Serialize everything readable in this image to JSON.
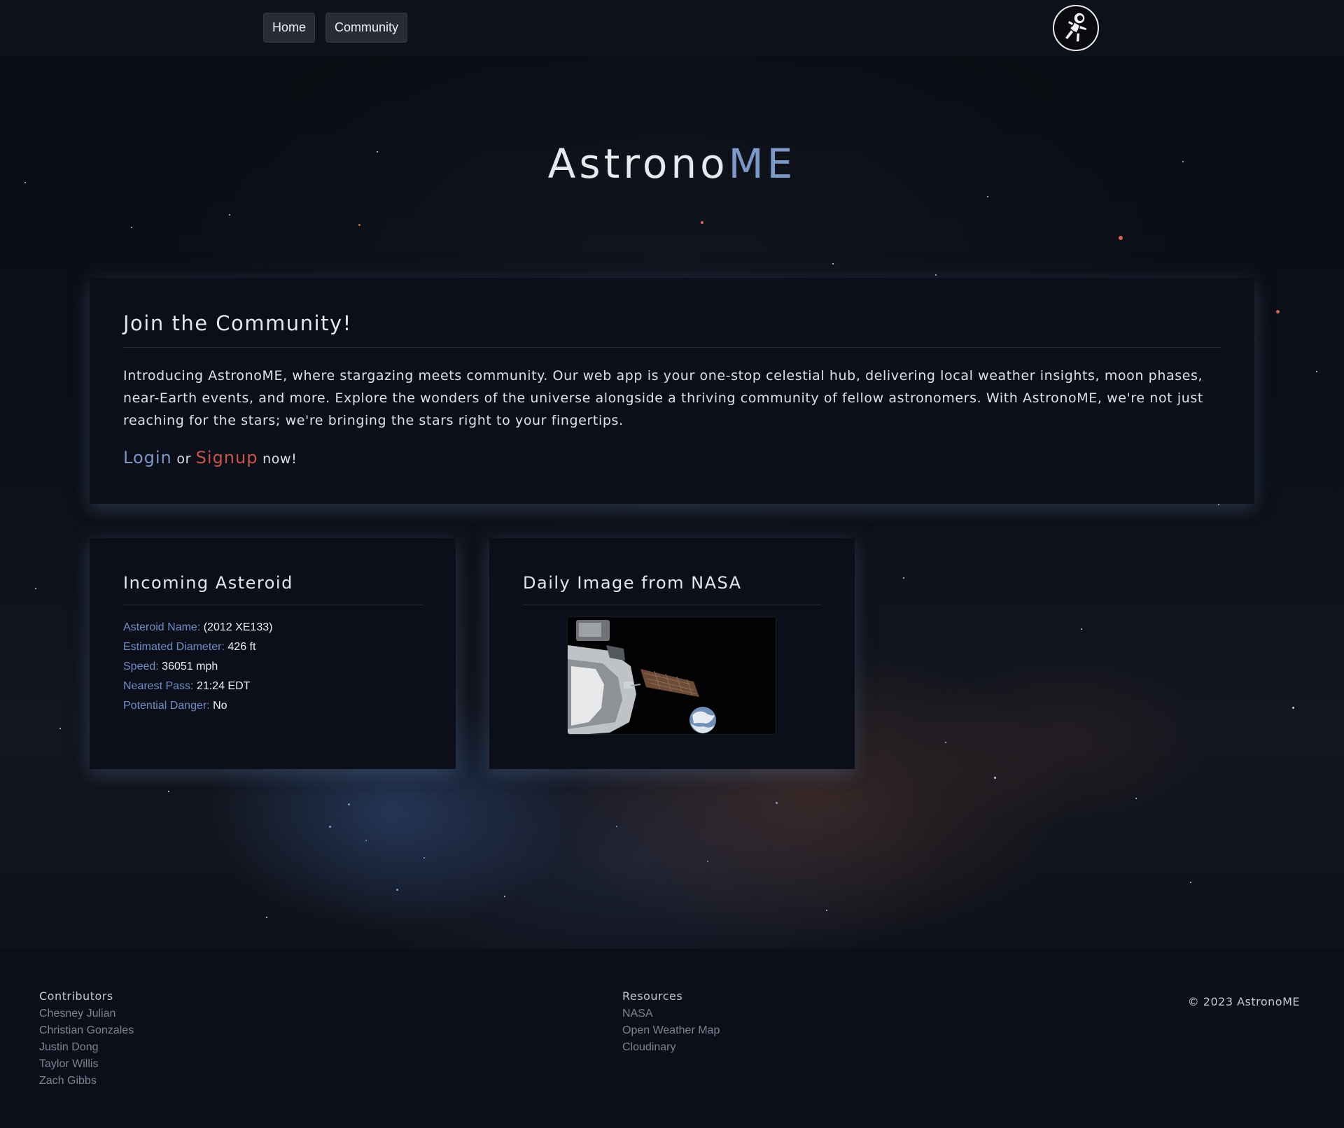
{
  "nav": {
    "home_label": "Home",
    "community_label": "Community",
    "logo_icon": "astronaut-icon"
  },
  "hero": {
    "title_main": "Astrono",
    "title_accent": "ME",
    "accent_color": "#7c98c7"
  },
  "join": {
    "title": "Join the Community!",
    "description": "Introducing AstronoME, where stargazing meets community. Our web app is your one-stop celestial hub, delivering local weather insights, moon phases, near-Earth events, and more. Explore the wonders of the universe alongside a thriving community of fellow astronomers. With AstronoME, we're not just reaching for the stars; we're bringing the stars right to your fingertips.",
    "login_label": "Login",
    "or_text": "or",
    "signup_label": "Signup",
    "now_text": "now!",
    "login_color": "#7c98c7",
    "signup_color": "#c6554a"
  },
  "asteroid": {
    "title": "Incoming Asteroid",
    "rows": [
      {
        "label": "Asteroid Name:",
        "value": "(2012 XE133)"
      },
      {
        "label": "Estimated Diameter:",
        "value": "426 ft"
      },
      {
        "label": "Speed:",
        "value": "36051 mph"
      },
      {
        "label": "Nearest Pass:",
        "value": "21:24 EDT"
      },
      {
        "label": "Potential Danger:",
        "value": "No"
      }
    ]
  },
  "nasa": {
    "title": "Daily Image from NASA"
  },
  "footer": {
    "contributors_heading": "Contributors",
    "contributors": [
      "Chesney Julian",
      "Christian Gonzales",
      "Justin Dong",
      "Taylor Willis",
      "Zach Gibbs"
    ],
    "resources_heading": "Resources",
    "resources": [
      "NASA",
      "Open Weather Map",
      "Cloudinary"
    ],
    "copyright": "© 2023 AstronoME"
  }
}
